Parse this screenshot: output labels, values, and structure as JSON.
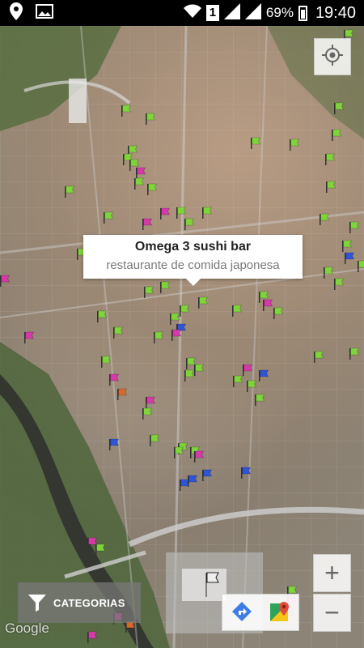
{
  "status_bar": {
    "icons_left": [
      "location-pin-icon",
      "image-icon"
    ],
    "icons_right": [
      "wifi-icon",
      "sim-indicator",
      "signal-icon",
      "signal-icon",
      "battery-icon"
    ],
    "sim": "1",
    "battery": "69%",
    "time": "19:40"
  },
  "map": {
    "attribution": "Google",
    "marker_colors": {
      "green": "#7fd43b",
      "magenta": "#d53aa8",
      "blue": "#2f54d6",
      "orange": "#d66a2a"
    }
  },
  "info_window": {
    "title": "Omega 3 sushi bar",
    "subtitle": "restaurante de comida japonesa"
  },
  "controls": {
    "categories_label": "CATEGORIAS",
    "zoom_in": "+",
    "zoom_out": "−"
  }
}
